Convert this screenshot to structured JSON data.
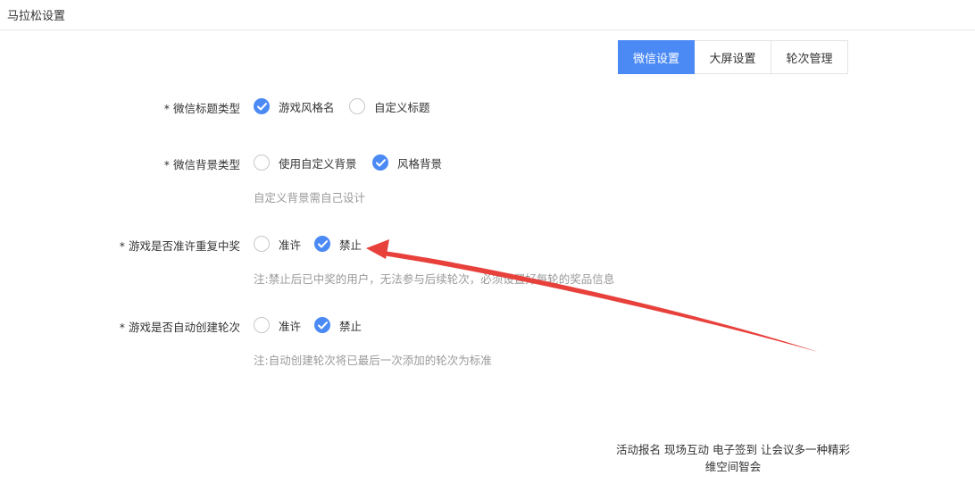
{
  "header": {
    "title": "马拉松设置"
  },
  "tabs": [
    {
      "label": "微信设置",
      "active": true
    },
    {
      "label": "大屏设置",
      "active": false
    },
    {
      "label": "轮次管理",
      "active": false
    }
  ],
  "form": {
    "title_type": {
      "label": "* 微信标题类型",
      "options": [
        {
          "label": "游戏风格名",
          "checked": true
        },
        {
          "label": "自定义标题",
          "checked": false
        }
      ]
    },
    "bg_type": {
      "label": "* 微信背景类型",
      "options": [
        {
          "label": "使用自定义背景",
          "checked": false
        },
        {
          "label": "风格背景",
          "checked": true
        }
      ],
      "hint": "自定义背景需自己设计"
    },
    "repeat_win": {
      "label": "* 游戏是否准许重复中奖",
      "options": [
        {
          "label": "准许",
          "checked": false
        },
        {
          "label": "禁止",
          "checked": true
        }
      ],
      "hint": "注:禁止后已中奖的用户，无法参与后续轮次，必须设置好每轮的奖品信息"
    },
    "auto_round": {
      "label": "* 游戏是否自动创建轮次",
      "options": [
        {
          "label": "准许",
          "checked": false
        },
        {
          "label": "禁止",
          "checked": true
        }
      ],
      "hint": "注:自动创建轮次将已最后一次添加的轮次为标准"
    }
  },
  "footer": {
    "line1": "活动报名 现场互动 电子签到 让会议多一种精彩",
    "line2": "维空间智会"
  },
  "colors": {
    "accent": "#4b8af5",
    "annotation_arrow": "#e8413c",
    "hint": "#999999"
  }
}
